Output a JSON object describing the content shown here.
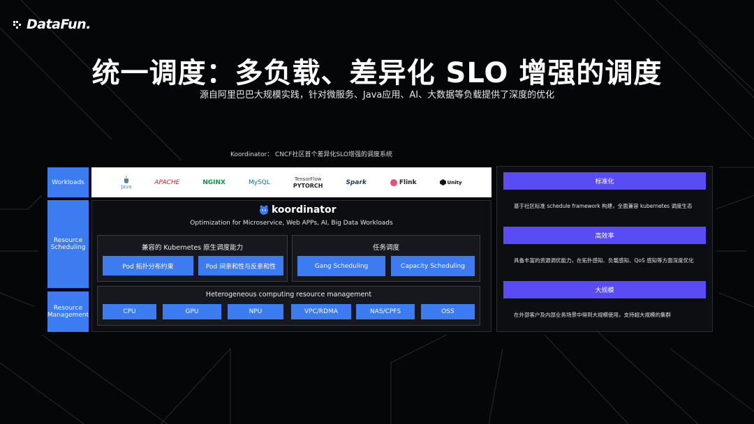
{
  "brand": {
    "name": "DataFun."
  },
  "title": "统一调度：多负载、差异化 SLO 增强的调度",
  "subtitle": "源自阿里巴巴大规模实践，针对微服务、Java应用、AI、大数据等负载提供了深度的优化",
  "caption": "Koordinator： CNCF社区首个差异化SLO增强的调度系统",
  "layers": {
    "workloads": "Workloads",
    "scheduling": "Resource Scheduling",
    "management": "Resource Management"
  },
  "workload_logos": [
    {
      "name": "java-logo",
      "text": "Java",
      "color": "#e8761f"
    },
    {
      "name": "apache-logo",
      "text": "APACHE",
      "color": "#c8262e"
    },
    {
      "name": "nginx-logo",
      "text": "NGINX",
      "color": "#0f9a45"
    },
    {
      "name": "mysql-logo",
      "text": "MySQL",
      "color": "#00758f"
    },
    {
      "name": "tensorflow-pytorch-logo",
      "text": "TensorFlow",
      "text2": "PYTORCH",
      "color": "#ee4c2c"
    },
    {
      "name": "spark-logo",
      "text": "Spark",
      "color": "#1c3a5e"
    },
    {
      "name": "flink-logo",
      "text": "Flink",
      "color": "#222222"
    },
    {
      "name": "unity-logo",
      "text": "Unity",
      "color": "#111111"
    }
  ],
  "koordinator": {
    "name": "koordinator",
    "tagline": "Optimization for Microservice, Web APPs, AI, Big Data Workloads"
  },
  "k8s_panel": {
    "title": "兼容的 Kubernetes 原生调度能力",
    "buttons": [
      "Pod 拓扑分布约束",
      "Pod 间亲和性与反亲和性"
    ]
  },
  "task_panel": {
    "title": "任务调度",
    "buttons": [
      "Gang Scheduling",
      "Capacity Scheduling"
    ]
  },
  "hetero_panel": {
    "title": "Heterogeneous computing resource management",
    "buttons": [
      "CPU",
      "GPU",
      "NPU",
      "VPC/RDMA",
      "NAS/CPFS",
      "OSS"
    ]
  },
  "features": [
    {
      "title": "标准化",
      "desc": "基于社区标准 schedule framework 构建，全面兼容 kubernetes 调度生态"
    },
    {
      "title": "高效率",
      "desc": "具备丰富的资源调优能力，在拓扑感知、负载感知、QoS 感知等方面深度优化"
    },
    {
      "title": "大规模",
      "desc": "在外部客户及内部业务场景中得到大规模使用，支持超大规模的集群"
    }
  ],
  "colors": {
    "accent_blue": "#3c7bf0",
    "accent_purple": "#5a4cf5",
    "background": "#050608"
  }
}
